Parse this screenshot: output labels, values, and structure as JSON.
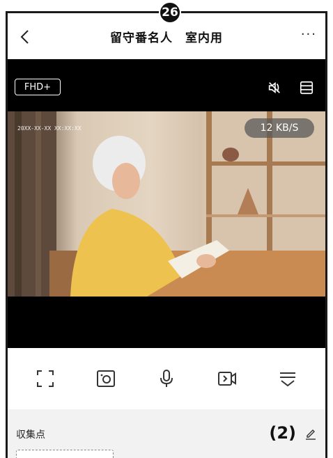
{
  "badge": "26",
  "header": {
    "title": "留守番名人　室内用",
    "more": "···"
  },
  "stream": {
    "quality": "FHD+",
    "timestamp": "20XX-XX-XX XX:XX:XX",
    "speed": "12 KB/S"
  },
  "panel": {
    "label": "収集点",
    "number": "(2)"
  },
  "colors": {
    "bar": "#000000",
    "panel": "#f2f2f2",
    "icon": "#333333"
  }
}
